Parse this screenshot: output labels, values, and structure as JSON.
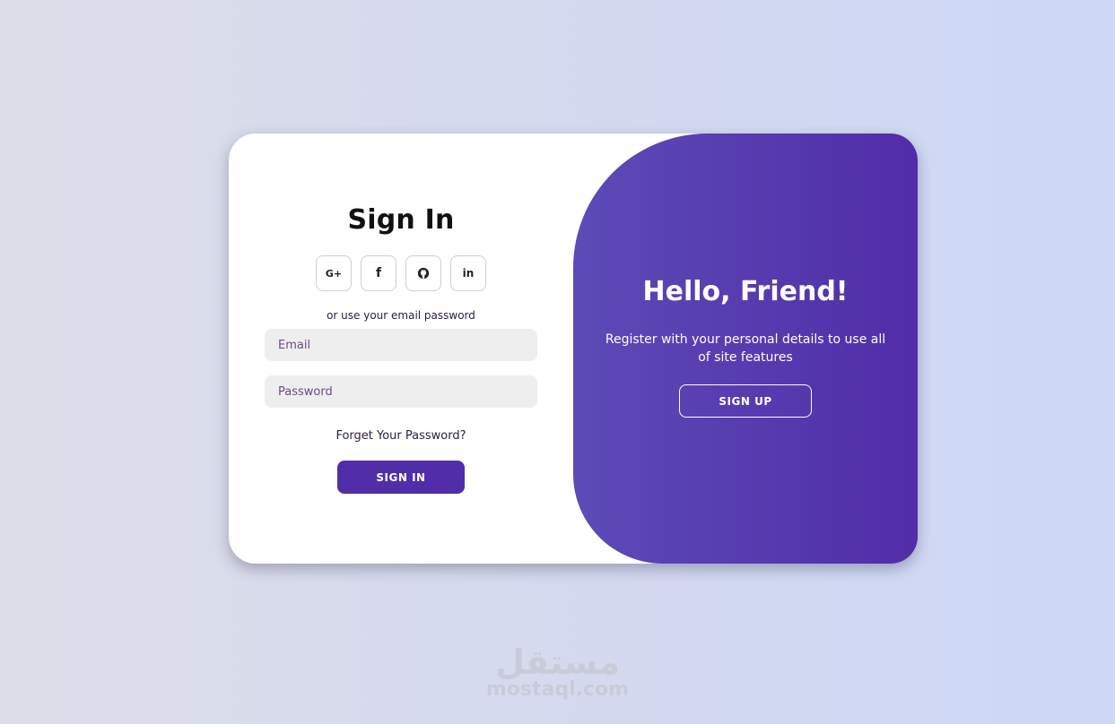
{
  "signin": {
    "title": "Sign In",
    "socials": [
      {
        "icon": "google-plus-icon",
        "label": "G+"
      },
      {
        "icon": "facebook-icon",
        "label": "f"
      },
      {
        "icon": "github-icon",
        "label": ""
      },
      {
        "icon": "linkedin-icon",
        "label": "in"
      }
    ],
    "alt_text": "or use your email password",
    "email_placeholder": "Email",
    "password_placeholder": "Password",
    "forgot_link": "Forget Your Password?",
    "submit_label": "SIGN IN"
  },
  "panel": {
    "title": "Hello, Friend!",
    "text": "Register with your personal details to use all of site features",
    "button_label": "SIGN UP"
  },
  "watermark": {
    "arabic": "مستقل",
    "latin": "mostaql.com"
  },
  "colors": {
    "accent": "#512da8",
    "panel_gradient_start": "#5c4bb7",
    "input_bg": "#eeeeee"
  }
}
